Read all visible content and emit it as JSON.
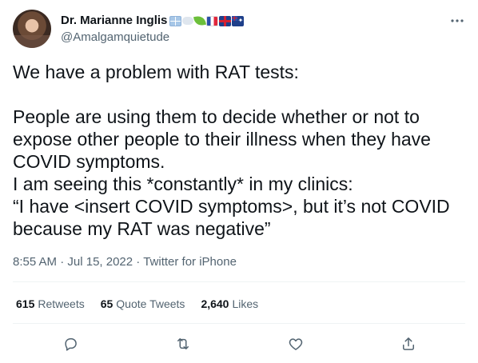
{
  "author": {
    "display_name": "Dr. Marianne Inglis",
    "handle": "@Amalgamquietude",
    "name_emojis": [
      "window-emoji",
      "cloud-emoji",
      "leaf-emoji",
      "france-flag-emoji",
      "uk-flag-emoji",
      "australia-flag-emoji"
    ]
  },
  "tweet": {
    "line1": "We have a problem with RAT tests:",
    "line2": "People are using them to decide whether or not to",
    "line3": "expose other people to their illness when they have",
    "line4": "COVID symptoms.",
    "line5": "I am seeing this *constantly* in my clinics:",
    "line6": "“I have <insert COVID symptoms>, but it’s not COVID",
    "line7": "because my RAT was negative”"
  },
  "meta": {
    "time": "8:55 AM",
    "sep1": " · ",
    "date": "Jul 15, 2022",
    "sep2": " · ",
    "source": "Twitter for iPhone"
  },
  "stats": {
    "retweets_count": "615",
    "retweets_label": "Retweets",
    "quotes_count": "65",
    "quotes_label": "Quote Tweets",
    "likes_count": "2,640",
    "likes_label": "Likes"
  },
  "icons": {
    "more": "more-options-icon",
    "reply": "reply-icon",
    "retweet": "retweet-icon",
    "like": "like-icon",
    "share": "share-icon"
  },
  "colors": {
    "text_primary": "#0f1419",
    "text_secondary": "#536471",
    "divider": "#eff3f4"
  }
}
